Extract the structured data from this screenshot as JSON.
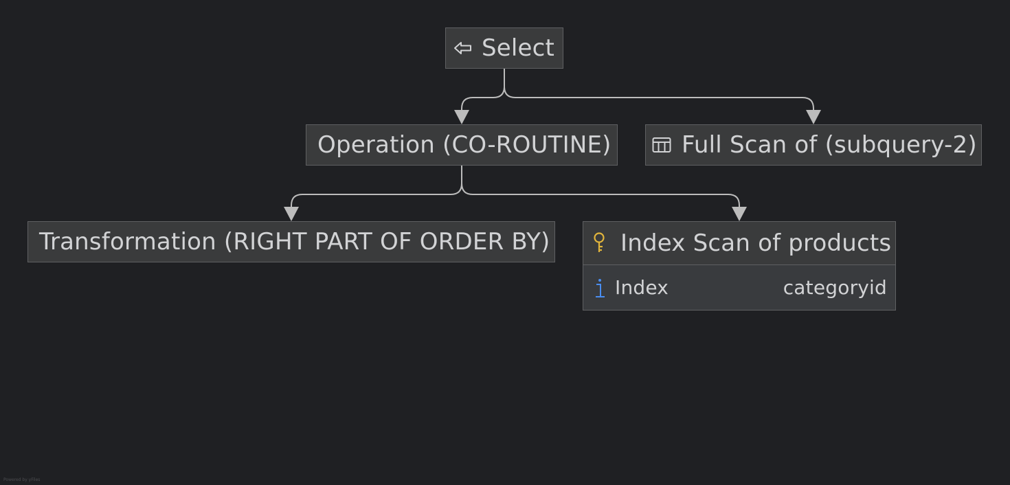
{
  "diagram": {
    "nodes": {
      "select": {
        "label": "Select",
        "icon": "return-arrow-icon"
      },
      "operation": {
        "label": "Operation (CO-ROUTINE)"
      },
      "full_scan": {
        "label": "Full Scan of (subquery-2)",
        "icon": "table-icon"
      },
      "transformation": {
        "label": "Transformation (RIGHT PART OF ORDER BY)"
      },
      "index_scan": {
        "label": "Index Scan of products",
        "icon": "key-icon",
        "properties": [
          {
            "name": "Index",
            "value": "categoryid",
            "icon": "info-icon"
          }
        ]
      }
    },
    "edges": [
      {
        "from": "select",
        "to": "operation"
      },
      {
        "from": "select",
        "to": "full_scan"
      },
      {
        "from": "operation",
        "to": "transformation"
      },
      {
        "from": "operation",
        "to": "index_scan"
      }
    ]
  },
  "colors": {
    "background": "#1f2023",
    "node_fill": "#3a3b3c",
    "node_border": "#5f6062",
    "text": "#d2d3d5",
    "edge": "#bcbcbc",
    "key_icon": "#e2b53c",
    "info_icon": "#4a8df0"
  },
  "footer": {
    "watermark": "Powered by yFiles"
  }
}
